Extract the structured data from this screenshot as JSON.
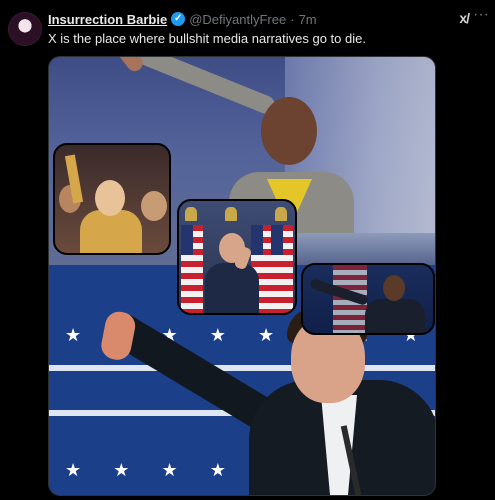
{
  "tweet": {
    "author_name": "Insurrection Barbie",
    "handle": "@DefiyantlyFree",
    "separator": "·",
    "time": "7m",
    "verified_mark": "✓",
    "text": "X is the place where bullshit media narratives go to die."
  },
  "icons": {
    "grok": "x/",
    "more": "···"
  },
  "colors": {
    "background": "#000000",
    "text_primary": "#e7e9ea",
    "text_secondary": "#71767b",
    "verified_blue": "#1d9bf0"
  },
  "media": {
    "star": "★"
  }
}
